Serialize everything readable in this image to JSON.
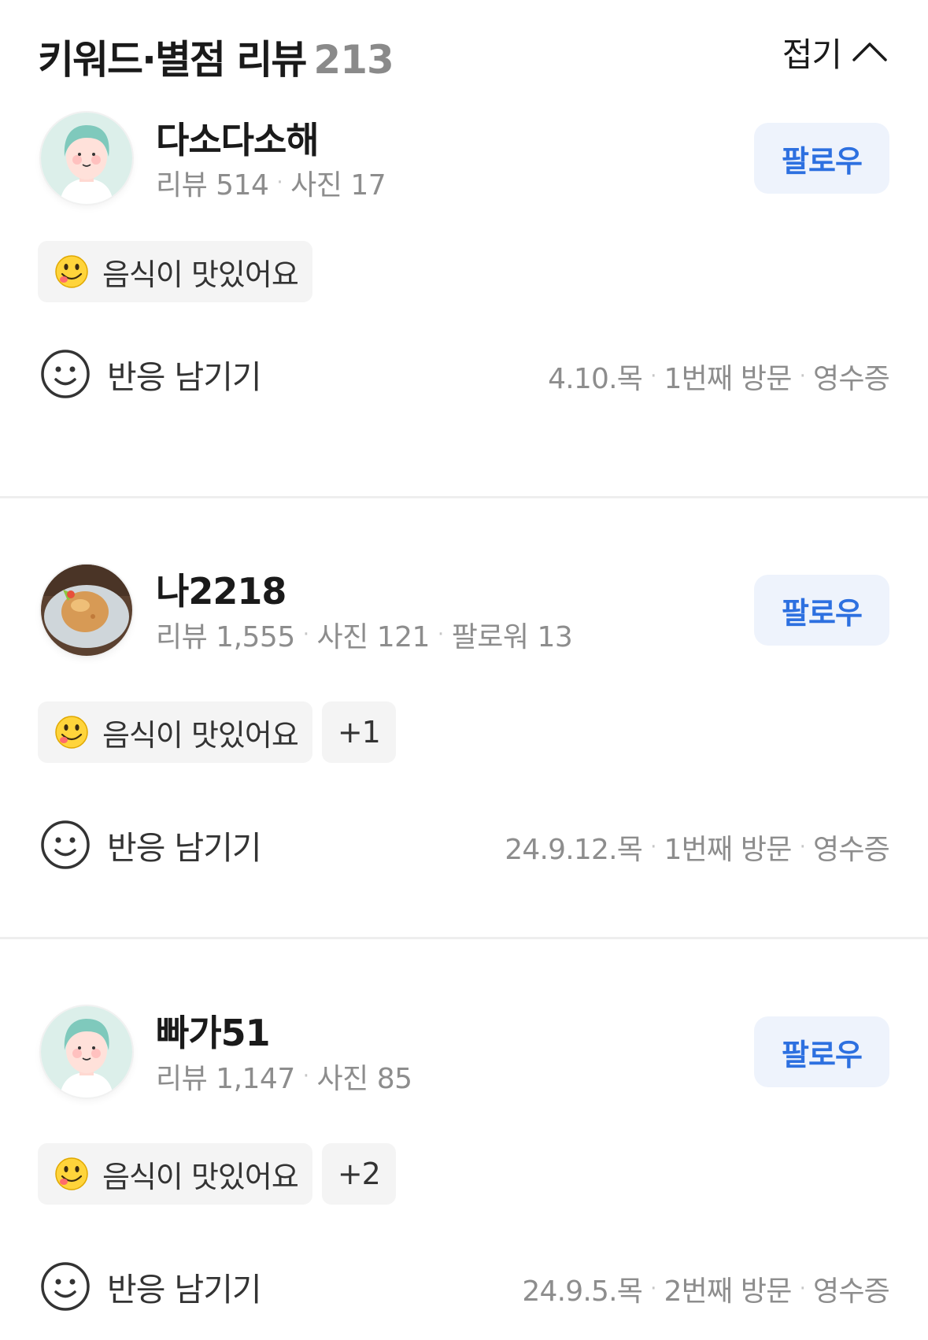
{
  "header": {
    "title": "키워드·별점 리뷰",
    "count": "213",
    "collapse_label": "접기"
  },
  "reviews": [
    {
      "name": "다소다소해",
      "stats": [
        "리뷰 514",
        "사진 17"
      ],
      "avatar": "default-avatar",
      "follow_label": "팔로우",
      "tags": [
        {
          "emoji": "yum-face-emoji",
          "label": "음식이 맛있어요"
        }
      ],
      "more_tags": "",
      "reaction_label": "반응 남기기",
      "meta": [
        "4.10.목",
        "1번째 방문",
        "영수증"
      ]
    },
    {
      "name": "나2218",
      "stats": [
        "리뷰 1,555",
        "사진 121",
        "팔로워 13"
      ],
      "avatar": "food-photo-avatar",
      "follow_label": "팔로우",
      "tags": [
        {
          "emoji": "yum-face-emoji",
          "label": "음식이 맛있어요"
        }
      ],
      "more_tags": "+1",
      "reaction_label": "반응 남기기",
      "meta": [
        "24.9.12.목",
        "1번째 방문",
        "영수증"
      ]
    },
    {
      "name": "빠가51",
      "stats": [
        "리뷰 1,147",
        "사진 85"
      ],
      "avatar": "default-avatar",
      "follow_label": "팔로우",
      "tags": [
        {
          "emoji": "yum-face-emoji",
          "label": "음식이 맛있어요"
        }
      ],
      "more_tags": "+2",
      "reaction_label": "반응 남기기",
      "meta": [
        "24.9.5.목",
        "2번째 방문",
        "영수증"
      ]
    }
  ],
  "colors": {
    "follow_text": "#2d70e0",
    "follow_bg": "#eef3fc",
    "tag_bg": "#f4f4f4",
    "muted_text": "#8d8d8d",
    "divider": "#eeeeee"
  }
}
